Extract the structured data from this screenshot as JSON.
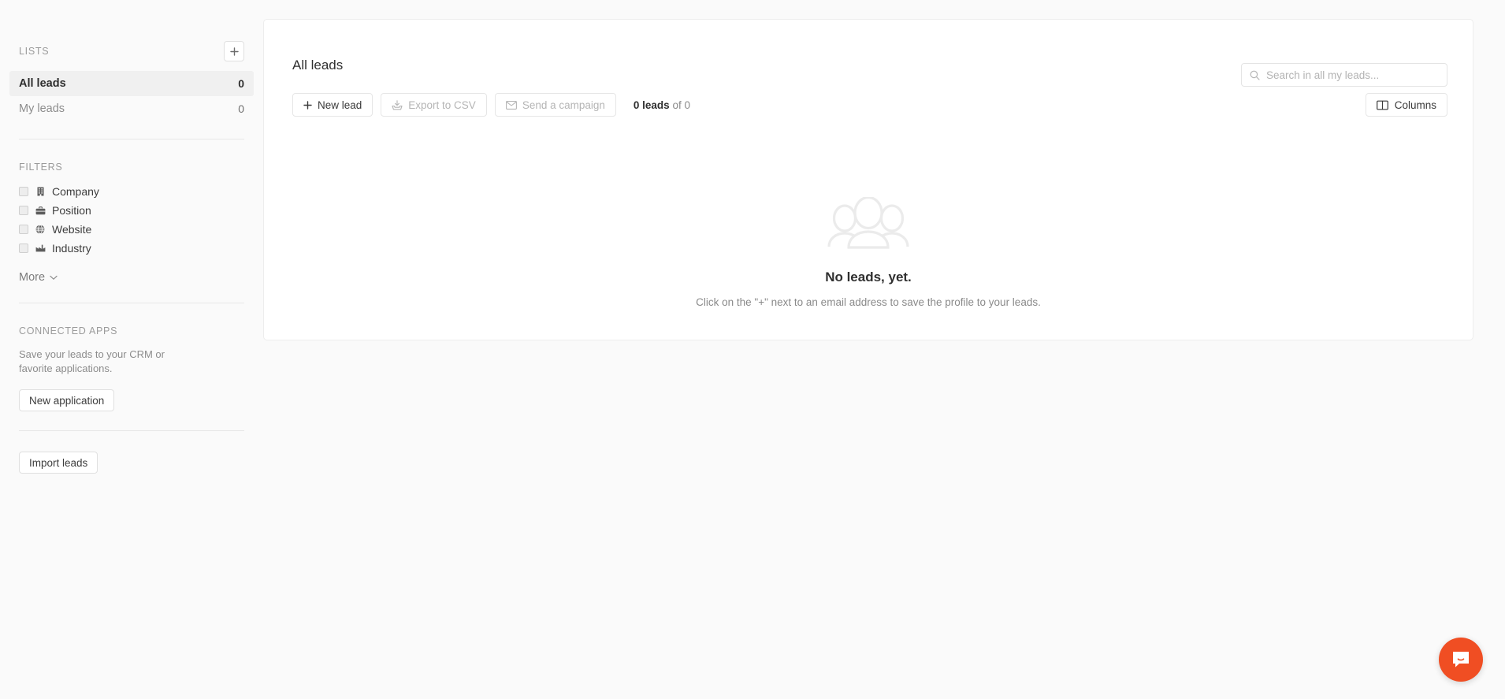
{
  "sidebar": {
    "lists_title": "LISTS",
    "add_list_label": "+",
    "lists": [
      {
        "label": "All leads",
        "count": "0"
      },
      {
        "label": "My leads",
        "count": "0"
      }
    ],
    "filters_title": "FILTERS",
    "filters": [
      {
        "label": "Company",
        "icon": "building-icon"
      },
      {
        "label": "Position",
        "icon": "briefcase-icon"
      },
      {
        "label": "Website",
        "icon": "globe-icon"
      },
      {
        "label": "Industry",
        "icon": "factory-icon"
      }
    ],
    "more_label": "More",
    "apps_title": "CONNECTED APPS",
    "apps_desc": "Save your leads to your CRM or favorite applications.",
    "new_application_label": "New application",
    "import_leads_label": "Import leads"
  },
  "main": {
    "title": "All leads",
    "search": {
      "placeholder": "Search in all my leads...",
      "value": ""
    },
    "toolbar": {
      "new_lead_label": "New lead",
      "export_csv_label": "Export to CSV",
      "send_campaign_label": "Send a campaign",
      "count_bold": "0 leads",
      "count_rest": "of 0",
      "columns_label": "Columns"
    },
    "empty_state": {
      "title": "No leads, yet.",
      "subtitle": "Click on the \"+\" next to an email address to save the profile to your leads."
    }
  },
  "chat": {
    "label": "chat-bubble-icon",
    "color": "#f04e23"
  },
  "colors": {
    "page_bg": "#fafafa",
    "card_bg": "#ffffff",
    "border": "#ededed",
    "text": "#2f2f2f",
    "muted": "#8a8a8a",
    "accent": "#f04e23"
  }
}
